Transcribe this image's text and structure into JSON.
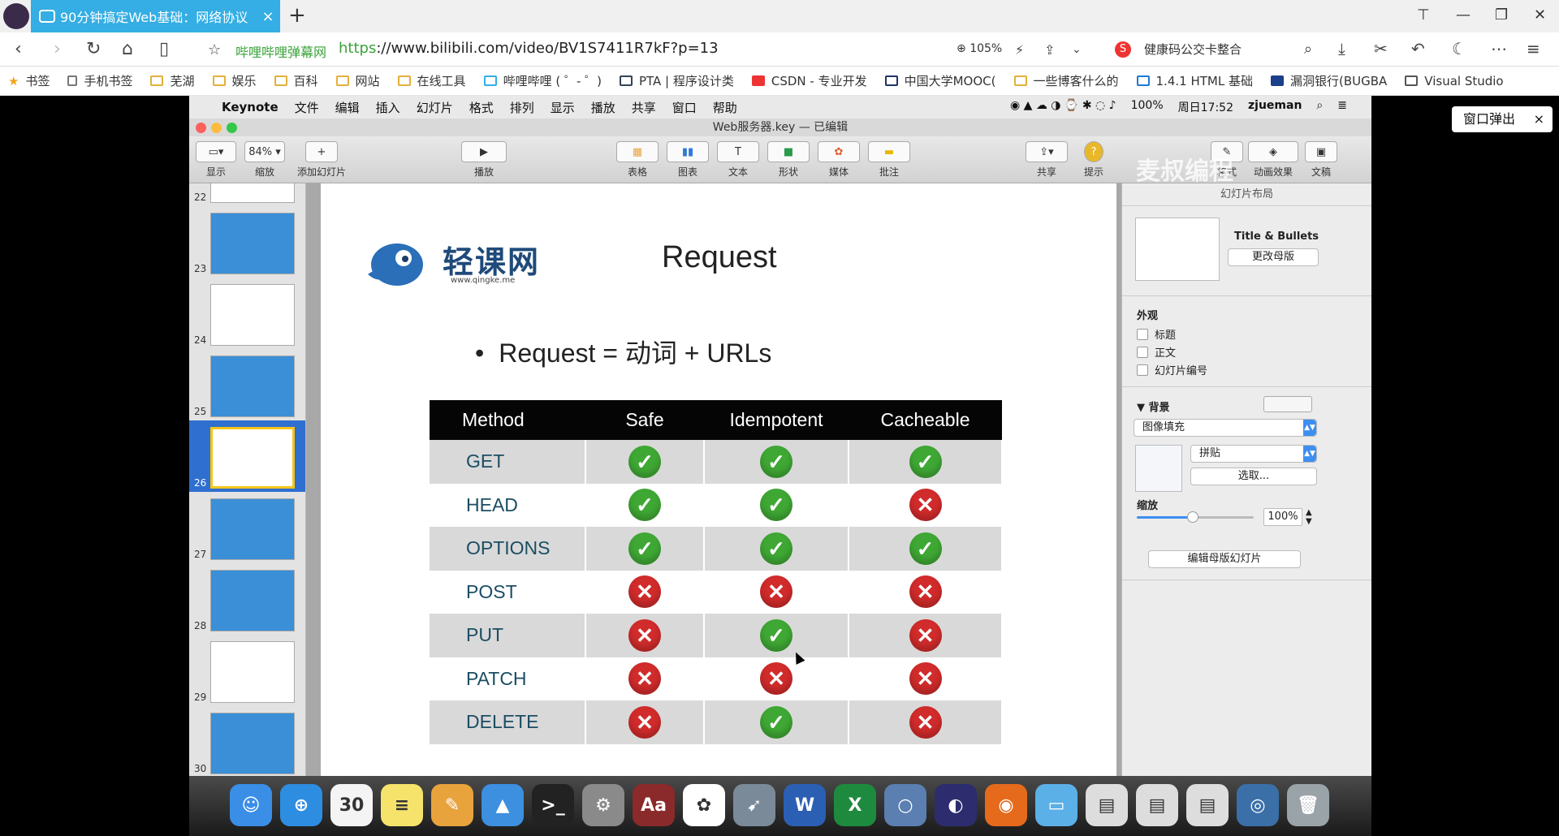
{
  "browser": {
    "tab_title": "90分钟搞定Web基础：网络协议",
    "tab_close": "×",
    "newtab": "+",
    "site_name": "哔哩哔哩弹幕网",
    "url_scheme": "https",
    "url_rest": "://www.bilibili.com/video/BV1S7411R7kF?p=13",
    "zoom": "105%",
    "search_text": "健康码公交卡整合",
    "search_icon_letter": "S",
    "back": "‹",
    "forward": "›",
    "reload": "↻",
    "home": "⌂",
    "reader": "▯",
    "bookmarks": [
      "书签",
      "手机书签",
      "芜湖",
      "娱乐",
      "百科",
      "网站",
      "在线工具",
      "哔哩哔哩 ( ゜- ゜)",
      "PTA | 程序设计类",
      "CSDN - 专业开发",
      "中国大学MOOC(",
      "一些博客什么的",
      "1.4.1 HTML 基础",
      "漏洞银行(BUGBA",
      "Visual Studio"
    ],
    "popout_label": "窗口弹出",
    "popout_close": "×",
    "window_buttons": [
      "⊤",
      "—",
      "❐",
      "✕"
    ]
  },
  "mac_menu": {
    "apple": "",
    "items": [
      "Keynote",
      "文件",
      "编辑",
      "插入",
      "幻灯片",
      "格式",
      "排列",
      "显示",
      "播放",
      "共享",
      "窗口",
      "帮助"
    ],
    "battery": "100%",
    "time": "周日17:52",
    "user": "zjueman"
  },
  "keynote": {
    "window_title": "Web服务器.key — 已编辑",
    "watermark": "麦叔编程",
    "toolbar": [
      {
        "label": "显示",
        "icon": "▭▾"
      },
      {
        "label": "缩放",
        "icon": "84% ▾"
      },
      {
        "label": "添加幻灯片",
        "icon": "+"
      },
      {
        "label": "播放",
        "icon": "▶"
      },
      {
        "label": "表格",
        "icon": "▦"
      },
      {
        "label": "图表",
        "icon": "▮▮"
      },
      {
        "label": "文本",
        "icon": "T"
      },
      {
        "label": "形状",
        "icon": "■"
      },
      {
        "label": "媒体",
        "icon": "✿"
      },
      {
        "label": "批注",
        "icon": "▬"
      },
      {
        "label": "共享",
        "icon": "⇪▾"
      },
      {
        "label": "提示",
        "icon": "?"
      },
      {
        "label": "格式",
        "icon": "✎"
      },
      {
        "label": "动画效果",
        "icon": "◈"
      },
      {
        "label": "文稿",
        "icon": "▣"
      }
    ],
    "thumbnails": [
      {
        "num": "22",
        "style": "white"
      },
      {
        "num": "23",
        "style": "blue"
      },
      {
        "num": "24",
        "style": "white"
      },
      {
        "num": "25",
        "style": "blue"
      },
      {
        "num": "26",
        "style": "white"
      },
      {
        "num": "27",
        "style": "blue"
      },
      {
        "num": "28",
        "style": "blue"
      },
      {
        "num": "29",
        "style": "white"
      },
      {
        "num": "30",
        "style": "blue"
      }
    ],
    "selected_thumbnail": "26"
  },
  "slide": {
    "brand_name": "轻课网",
    "brand_url": "www.qingke.me",
    "title": "Request",
    "bullet_dot": "•",
    "bullet": "Request = 动词 + URLs",
    "table_headers": [
      "Method",
      "Safe",
      "Idempotent",
      "Cacheable"
    ],
    "rows": [
      {
        "method": "GET",
        "safe": true,
        "idempotent": true,
        "cacheable": true
      },
      {
        "method": "HEAD",
        "safe": true,
        "idempotent": true,
        "cacheable": false
      },
      {
        "method": "OPTIONS",
        "safe": true,
        "idempotent": true,
        "cacheable": true
      },
      {
        "method": "POST",
        "safe": false,
        "idempotent": false,
        "cacheable": false
      },
      {
        "method": "PUT",
        "safe": false,
        "idempotent": true,
        "cacheable": false
      },
      {
        "method": "PATCH",
        "safe": false,
        "idempotent": false,
        "cacheable": false
      },
      {
        "method": "DELETE",
        "safe": false,
        "idempotent": true,
        "cacheable": false
      }
    ],
    "yes_glyph": "✓",
    "no_glyph": "✕"
  },
  "inspector": {
    "title": "幻灯片布局",
    "layout_name": "Title & Bullets",
    "change_master": "更改母版",
    "appearance": "外观",
    "checkbox_title": "标题",
    "checkbox_body": "正文",
    "checkbox_slide_number": "幻灯片编号",
    "background": "背景",
    "fill_type": "图像填充",
    "tile_option": "拼贴",
    "choose": "选取...",
    "scale_label": "缩放",
    "scale_value": "100%",
    "scale_level": 0.48,
    "edit_master": "编辑母版幻灯片"
  },
  "dock": {
    "apps": [
      {
        "name": "finder",
        "glyph": "☺",
        "color": "#3a8ee6"
      },
      {
        "name": "safari",
        "glyph": "⊕",
        "color": "#2d8de0"
      },
      {
        "name": "calendar",
        "glyph": "30",
        "color": "#f4f4f4"
      },
      {
        "name": "notes",
        "glyph": "≡",
        "color": "#f5e36b"
      },
      {
        "name": "pages",
        "glyph": "✎",
        "color": "#e8a33d"
      },
      {
        "name": "keynote",
        "glyph": "▲",
        "color": "#3d8fe0"
      },
      {
        "name": "terminal",
        "glyph": ">_",
        "color": "#222222"
      },
      {
        "name": "system-preferences",
        "glyph": "⚙",
        "color": "#8a8a8a"
      },
      {
        "name": "dictionary",
        "glyph": "Aa",
        "color": "#8b2a2a"
      },
      {
        "name": "photos",
        "glyph": "✿",
        "color": "#ffffff"
      },
      {
        "name": "launchpad",
        "glyph": "➹",
        "color": "#7a8a99"
      },
      {
        "name": "word",
        "glyph": "W",
        "color": "#2b5fb3"
      },
      {
        "name": "excel",
        "glyph": "X",
        "color": "#1e8a3e"
      },
      {
        "name": "qq",
        "glyph": "○",
        "color": "#5a7fb0"
      },
      {
        "name": "eclipse",
        "glyph": "◐",
        "color": "#2c2c6e"
      },
      {
        "name": "firefox",
        "glyph": "◉",
        "color": "#e66a1c"
      },
      {
        "name": "folder",
        "glyph": "▭",
        "color": "#5bb0e8"
      },
      {
        "name": "doc1",
        "glyph": "▤",
        "color": "#dddddd"
      },
      {
        "name": "doc2",
        "glyph": "▤",
        "color": "#dddddd"
      },
      {
        "name": "doc3",
        "glyph": "▤",
        "color": "#dddddd"
      },
      {
        "name": "disk",
        "glyph": "◎",
        "color": "#3a6fa8"
      },
      {
        "name": "trash",
        "glyph": "🗑",
        "color": "#9aa3a8"
      }
    ]
  }
}
